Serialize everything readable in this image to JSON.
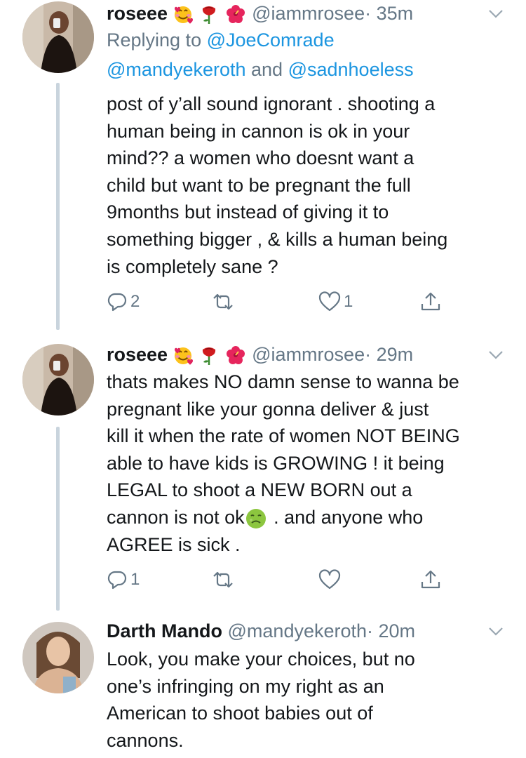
{
  "tweets": [
    {
      "name": "roseee",
      "handle": "@iammrosee",
      "time": "· 35m",
      "replying_prefix": "Replying to ",
      "replying_line1": "@JoeComrade",
      "replying_line2a": "@mandyekeroth",
      "replying_and": " and ",
      "replying_line2b": "@sadnhoeless",
      "lines": [
        "post of y’all sound ignorant . shooting a",
        "human being in cannon is ok in your",
        "mind?? a women who doesnt want a",
        "child but want to be pregnant the full",
        "9months but instead of giving it to",
        "something bigger , & kills a human being",
        "is completely sane ?"
      ],
      "replies": "2",
      "retweets": "",
      "likes": "1"
    },
    {
      "name": "roseee",
      "handle": "@iammrosee",
      "time": "· 29m",
      "lines": [
        "thats makes NO damn sense to wanna be",
        "pregnant like your gonna deliver & just",
        "kill it when the rate of women NOT BEING",
        "able to have kids is GROWING ! it being",
        "LEGAL to shoot a NEW BORN out a",
        "cannon is not ok",
        "AGREE is sick ."
      ],
      "line6_suffix": " . and anyone who",
      "replies": "1",
      "retweets": "",
      "likes": ""
    },
    {
      "name": "Darth Mando",
      "handle": "@mandyekeroth",
      "time": "· 20m",
      "lines": [
        "Look, you make your choices, but no",
        "one’s infringing on my right as an",
        "American to shoot babies out of",
        "cannons."
      ]
    }
  ],
  "icons": {
    "reply": "reply-icon",
    "retweet": "retweet-icon",
    "like": "heart-icon",
    "share": "share-icon",
    "menu": "chevron-down-icon",
    "name_emojis": [
      "smiling-face-with-hearts-emoji",
      "rose-emoji",
      "hibiscus-emoji"
    ],
    "inline_emoji": "nauseated-face-emoji"
  },
  "colors": {
    "link": "#1b95e0",
    "secondary_text": "#657786",
    "thread_line": "#c9d4dd"
  }
}
